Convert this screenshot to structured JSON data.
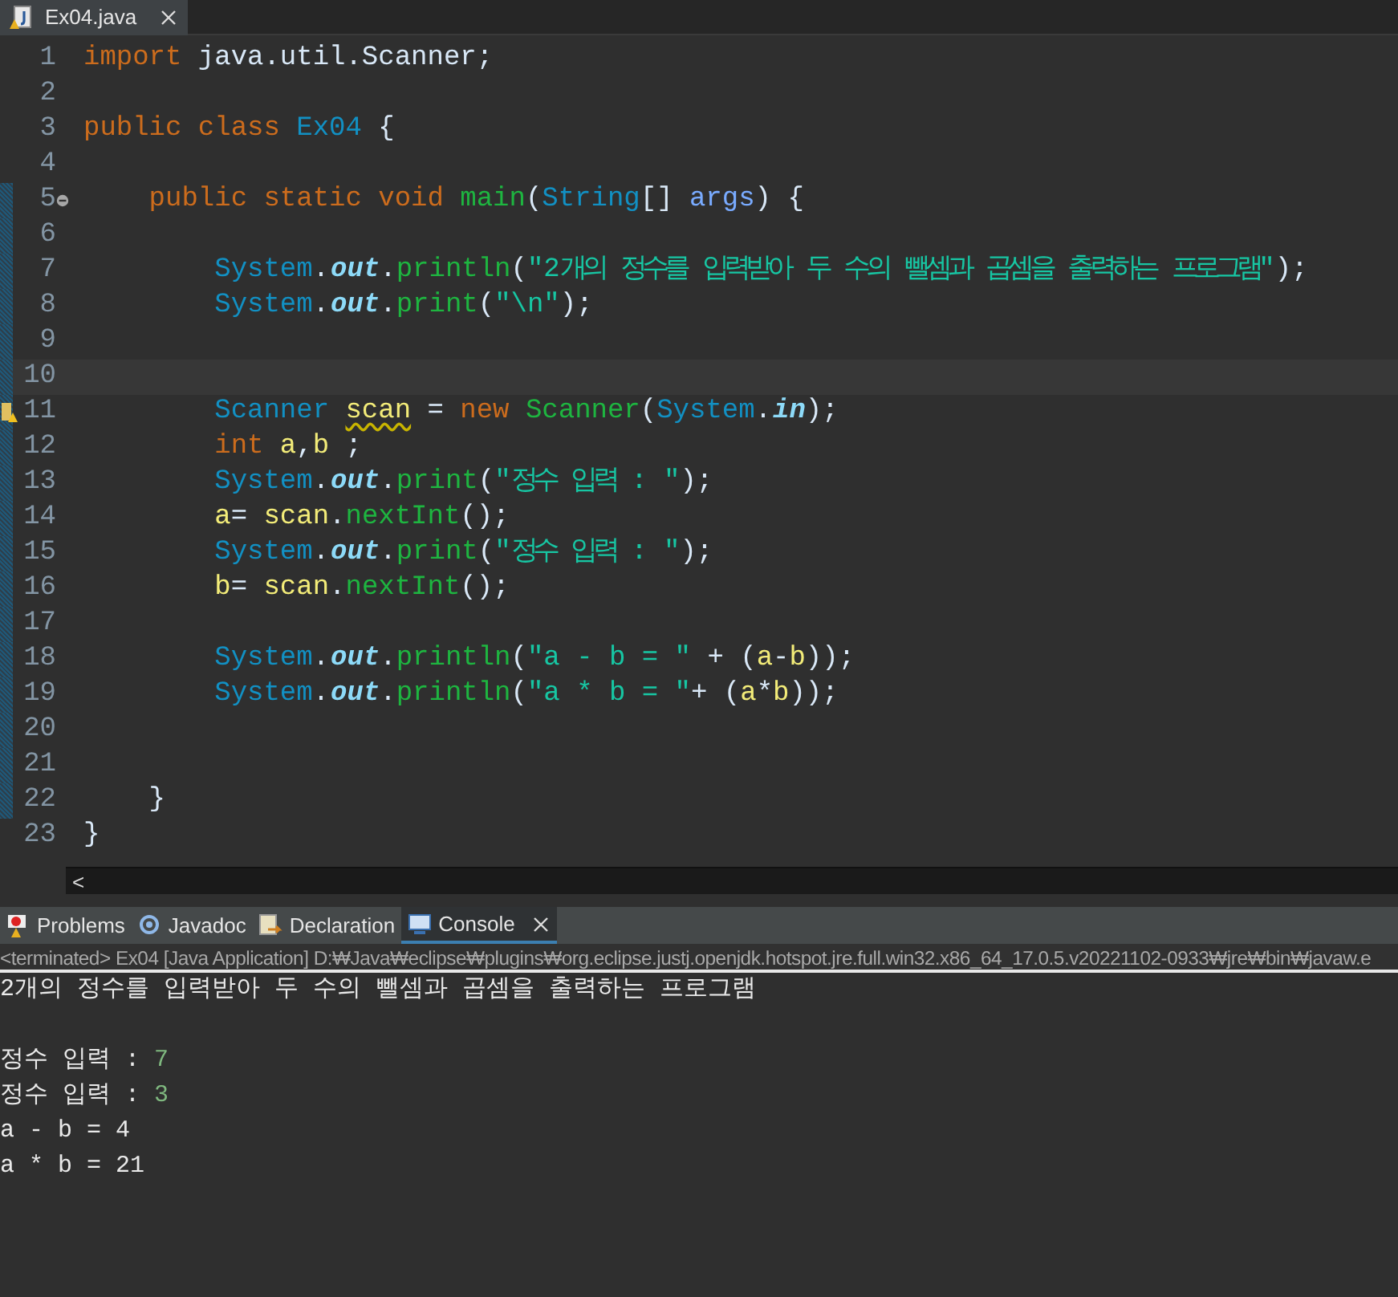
{
  "editor_tabs": [
    {
      "label": "Ex04.java",
      "selected": true
    }
  ],
  "code_lines": [
    {
      "number": "1",
      "kind": "plain",
      "tokens": [
        {
          "kind": "keyword",
          "text": "import"
        },
        {
          "kind": "plain",
          "text": " java.util.Scanner;"
        }
      ]
    },
    {
      "number": "2",
      "kind": "plain"
    },
    {
      "number": "3",
      "kind": "plain",
      "tokens": [
        {
          "kind": "keyword",
          "text": "public class "
        },
        {
          "kind": "type",
          "text": "Ex04"
        },
        {
          "kind": "plain",
          "text": " {"
        }
      ]
    },
    {
      "number": "4",
      "kind": "plain"
    },
    {
      "number": "5",
      "changed": true,
      "kind": "fold",
      "tokens": [
        {
          "kind": "keyword",
          "text": "    public static void "
        },
        {
          "kind": "method",
          "text": "main"
        },
        {
          "kind": "plain",
          "text": "("
        },
        {
          "kind": "type",
          "text": "String"
        },
        {
          "kind": "plain",
          "text": "[] "
        },
        {
          "kind": "param",
          "text": "args"
        },
        {
          "kind": "plain",
          "text": ") {"
        }
      ]
    },
    {
      "number": "6",
      "changed": true,
      "kind": "plain"
    },
    {
      "number": "7",
      "changed": true,
      "kind": "plain",
      "tokens": [
        {
          "kind": "type",
          "text": "        System"
        },
        {
          "kind": "plain",
          "text": "."
        },
        {
          "kind": "field",
          "text": "out"
        },
        {
          "kind": "plain",
          "text": "."
        },
        {
          "kind": "method",
          "text": "println"
        },
        {
          "kind": "plain",
          "text": "("
        },
        {
          "kind": "string",
          "text": "\"2개의 정수를 입력받아 두 수의 뺄셈과 곱셈을 출력하는 프로그램\""
        },
        {
          "kind": "plain",
          "text": ");"
        }
      ]
    },
    {
      "number": "8",
      "changed": true,
      "kind": "plain",
      "tokens": [
        {
          "kind": "type",
          "text": "        System"
        },
        {
          "kind": "plain",
          "text": "."
        },
        {
          "kind": "field",
          "text": "out"
        },
        {
          "kind": "plain",
          "text": "."
        },
        {
          "kind": "method",
          "text": "print"
        },
        {
          "kind": "plain",
          "text": "("
        },
        {
          "kind": "string",
          "text": "\"\\n\""
        },
        {
          "kind": "plain",
          "text": ");"
        }
      ]
    },
    {
      "number": "9",
      "changed": true,
      "kind": "plain"
    },
    {
      "number": "10",
      "changed": true,
      "current": true,
      "kind": "plain"
    },
    {
      "number": "11",
      "changed": true,
      "kind": "warning",
      "tokens": [
        {
          "kind": "type",
          "text": "        Scanner "
        },
        {
          "kind": "warned",
          "text": "scan"
        },
        {
          "kind": "plain",
          "text": " = "
        },
        {
          "kind": "keyword",
          "text": "new "
        },
        {
          "kind": "method",
          "text": "Scanner"
        },
        {
          "kind": "plain",
          "text": "("
        },
        {
          "kind": "type",
          "text": "System"
        },
        {
          "kind": "plain",
          "text": "."
        },
        {
          "kind": "field",
          "text": "in"
        },
        {
          "kind": "plain",
          "text": ");"
        }
      ]
    },
    {
      "number": "12",
      "changed": true,
      "kind": "plain",
      "tokens": [
        {
          "kind": "keyword",
          "text": "        int "
        },
        {
          "kind": "variable",
          "text": "a"
        },
        {
          "kind": "plain",
          "text": ","
        },
        {
          "kind": "variable",
          "text": "b"
        },
        {
          "kind": "plain",
          "text": " ;"
        }
      ]
    },
    {
      "number": "13",
      "changed": true,
      "kind": "plain",
      "tokens": [
        {
          "kind": "type",
          "text": "        System"
        },
        {
          "kind": "plain",
          "text": "."
        },
        {
          "kind": "field",
          "text": "out"
        },
        {
          "kind": "plain",
          "text": "."
        },
        {
          "kind": "method",
          "text": "print"
        },
        {
          "kind": "plain",
          "text": "("
        },
        {
          "kind": "string",
          "text": "\"정수 입력 : \""
        },
        {
          "kind": "plain",
          "text": ");"
        }
      ]
    },
    {
      "number": "14",
      "changed": true,
      "kind": "plain",
      "tokens": [
        {
          "kind": "variable",
          "text": "        a"
        },
        {
          "kind": "plain",
          "text": "= "
        },
        {
          "kind": "variable",
          "text": "scan"
        },
        {
          "kind": "plain",
          "text": "."
        },
        {
          "kind": "method",
          "text": "nextInt"
        },
        {
          "kind": "plain",
          "text": "();"
        }
      ]
    },
    {
      "number": "15",
      "changed": true,
      "kind": "plain",
      "tokens": [
        {
          "kind": "type",
          "text": "        System"
        },
        {
          "kind": "plain",
          "text": "."
        },
        {
          "kind": "field",
          "text": "out"
        },
        {
          "kind": "plain",
          "text": "."
        },
        {
          "kind": "method",
          "text": "print"
        },
        {
          "kind": "plain",
          "text": "("
        },
        {
          "kind": "string",
          "text": "\"정수 입력 : \""
        },
        {
          "kind": "plain",
          "text": ");"
        }
      ]
    },
    {
      "number": "16",
      "changed": true,
      "kind": "plain",
      "tokens": [
        {
          "kind": "variable",
          "text": "        b"
        },
        {
          "kind": "plain",
          "text": "= "
        },
        {
          "kind": "variable",
          "text": "scan"
        },
        {
          "kind": "plain",
          "text": "."
        },
        {
          "kind": "method",
          "text": "nextInt"
        },
        {
          "kind": "plain",
          "text": "();"
        }
      ]
    },
    {
      "number": "17",
      "changed": true,
      "kind": "plain"
    },
    {
      "number": "18",
      "changed": true,
      "kind": "plain",
      "tokens": [
        {
          "kind": "type",
          "text": "        System"
        },
        {
          "kind": "plain",
          "text": "."
        },
        {
          "kind": "field",
          "text": "out"
        },
        {
          "kind": "plain",
          "text": "."
        },
        {
          "kind": "method",
          "text": "println"
        },
        {
          "kind": "plain",
          "text": "("
        },
        {
          "kind": "string",
          "text": "\"a - b = \""
        },
        {
          "kind": "plain",
          "text": " + ("
        },
        {
          "kind": "variable",
          "text": "a"
        },
        {
          "kind": "plain",
          "text": "-"
        },
        {
          "kind": "variable",
          "text": "b"
        },
        {
          "kind": "plain",
          "text": "));"
        }
      ]
    },
    {
      "number": "19",
      "changed": true,
      "kind": "plain",
      "tokens": [
        {
          "kind": "type",
          "text": "        System"
        },
        {
          "kind": "plain",
          "text": "."
        },
        {
          "kind": "field",
          "text": "out"
        },
        {
          "kind": "plain",
          "text": "."
        },
        {
          "kind": "method",
          "text": "println"
        },
        {
          "kind": "plain",
          "text": "("
        },
        {
          "kind": "string",
          "text": "\"a * b = \""
        },
        {
          "kind": "plain",
          "text": "+ ("
        },
        {
          "kind": "variable",
          "text": "a"
        },
        {
          "kind": "plain",
          "text": "*"
        },
        {
          "kind": "variable",
          "text": "b"
        },
        {
          "kind": "plain",
          "text": "));"
        }
      ]
    },
    {
      "number": "20",
      "changed": true,
      "kind": "plain"
    },
    {
      "number": "21",
      "changed": true,
      "kind": "plain"
    },
    {
      "number": "22",
      "changed": true,
      "kind": "plain",
      "tokens": [
        {
          "kind": "plain",
          "text": "    }"
        }
      ]
    },
    {
      "number": "23",
      "kind": "plain",
      "tokens": [
        {
          "kind": "plain",
          "text": "}"
        }
      ]
    }
  ],
  "scrollbar_arrow": "<",
  "panel_tabs": [
    {
      "label": "Problems",
      "selected": false,
      "closable": false
    },
    {
      "label": "Javadoc",
      "selected": false,
      "closable": false
    },
    {
      "label": "Declaration",
      "selected": false,
      "closable": false
    },
    {
      "label": "Console",
      "selected": true,
      "closable": true
    }
  ],
  "console": {
    "header": "<terminated> Ex04 [Java Application] D:₩Java₩eclipse₩plugins₩org.eclipse.justj.openjdk.hotspot.jre.full.win32.x86_64_17.0.5.v20221102-0933₩jre₩bin₩javaw.e",
    "lines": [
      {
        "parts": [
          {
            "kind": "output",
            "text": "2개의 정수를 입력받아 두 수의 뺄셈과 곱셈을 출력하는 프로그램"
          }
        ]
      },
      {
        "parts": [
          {
            "kind": "output",
            "text": "정수 입력 : "
          },
          {
            "kind": "input",
            "text": "7"
          }
        ]
      },
      {
        "parts": [
          {
            "kind": "output",
            "text": "정수 입력 : "
          },
          {
            "kind": "input",
            "text": "3"
          }
        ]
      },
      {
        "parts": [
          {
            "kind": "output",
            "text": "a - b = 4"
          }
        ]
      },
      {
        "parts": [
          {
            "kind": "output",
            "text": "a * b = 21"
          }
        ]
      }
    ]
  }
}
